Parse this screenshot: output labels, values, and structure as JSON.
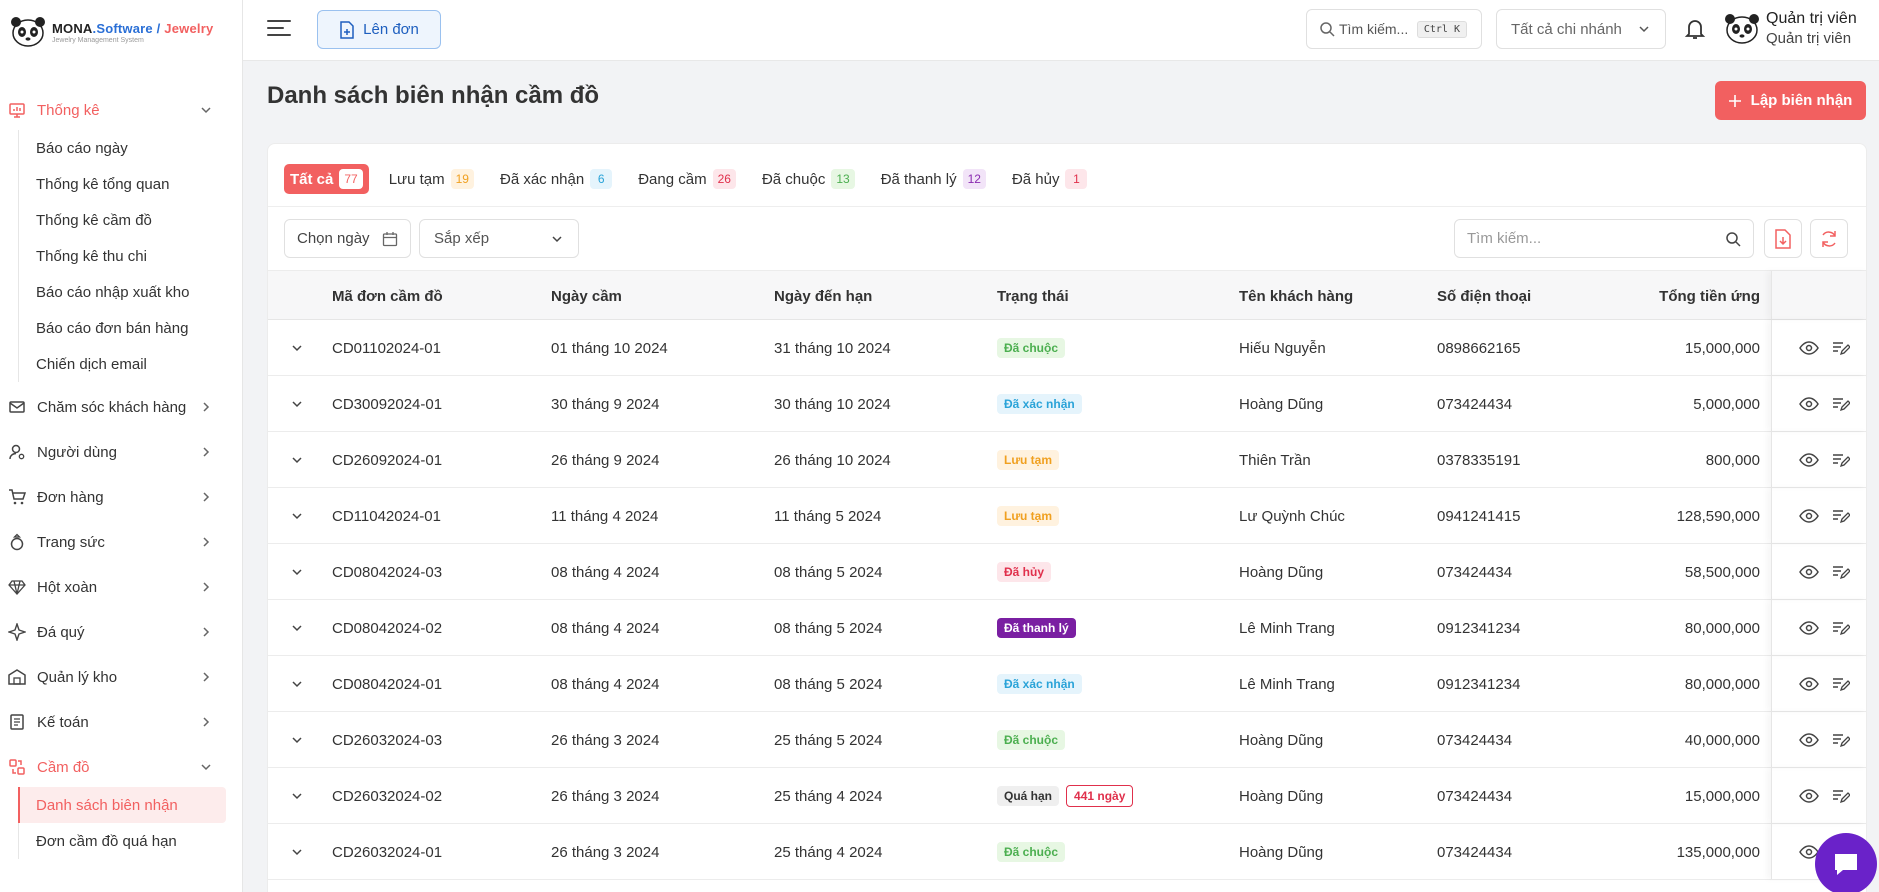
{
  "brand": {
    "name_main": "MONA",
    "name_dot": ".Software",
    "name_sep": " / ",
    "name_jewelry": "Jewelry",
    "subtitle": "Jewelry Management System"
  },
  "sidebar": {
    "groups": [
      {
        "label": "Thống kê",
        "icon": "chart-icon",
        "expanded": true,
        "active": true,
        "items": [
          "Báo cáo ngày",
          "Thống kê tổng quan",
          "Thống kê cầm đồ",
          "Thống kê thu chi",
          "Báo cáo nhập xuất kho",
          "Báo cáo đơn bán hàng",
          "Chiến dịch email"
        ]
      },
      {
        "label": "Chăm sóc khách hàng",
        "icon": "mail-icon"
      },
      {
        "label": "Người dùng",
        "icon": "user-gear-icon"
      },
      {
        "label": "Đơn hàng",
        "icon": "cart-icon"
      },
      {
        "label": "Trang sức",
        "icon": "ring-icon"
      },
      {
        "label": "Hột xoàn",
        "icon": "diamond-icon"
      },
      {
        "label": "Đá quý",
        "icon": "gem-icon"
      },
      {
        "label": "Quản lý kho",
        "icon": "warehouse-icon"
      },
      {
        "label": "Kế toán",
        "icon": "ledger-icon"
      },
      {
        "label": "Cầm đồ",
        "icon": "pawn-icon",
        "expanded": true,
        "active": true,
        "items": [
          "Danh sách biên nhận",
          "Đơn cầm đồ quá hạn"
        ],
        "active_item": 0
      }
    ]
  },
  "topbar": {
    "create_label": "Lên đơn",
    "search_label": "Tìm kiếm...",
    "search_shortcut": "Ctrl K",
    "branch_label": "Tất cả chi nhánh",
    "user_name": "Quản trị viên",
    "user_role": "Quản trị viên"
  },
  "page": {
    "title": "Danh sách biên nhận cầm đồ",
    "add_label": "Lập biên nhận",
    "tabs": [
      {
        "label": "Tất cả",
        "count": "77",
        "active": true,
        "color": "#f26060"
      },
      {
        "label": "Lưu tạm",
        "count": "19",
        "bg": "#fff2df",
        "fg": "#f0a020"
      },
      {
        "label": "Đã xác nhận",
        "count": "6",
        "bg": "#e5f4fc",
        "fg": "#2aa3d8"
      },
      {
        "label": "Đang cầm",
        "count": "26",
        "bg": "#fde6ea",
        "fg": "#e0304c"
      },
      {
        "label": "Đã chuộc",
        "count": "13",
        "bg": "#e7f7e3",
        "fg": "#4caf50"
      },
      {
        "label": "Đã thanh lý",
        "count": "12",
        "bg": "#f2e4f8",
        "fg": "#8a2bb0"
      },
      {
        "label": "Đã hủy",
        "count": "1",
        "bg": "#fde6ea",
        "fg": "#e0304c"
      }
    ],
    "date_placeholder": "Chọn ngày",
    "sort_placeholder": "Sắp xếp",
    "table_search_placeholder": "Tìm kiếm..."
  },
  "table": {
    "columns": [
      "Mã đơn cầm đồ",
      "Ngày cầm",
      "Ngày đến hạn",
      "Trạng thái",
      "Tên khách hàng",
      "Số điện thoại",
      "Tổng tiền ứng"
    ],
    "rows": [
      {
        "code": "CD01102024-01",
        "date": "01 tháng 10 2024",
        "due": "31 tháng 10 2024",
        "status": "Đã chuộc",
        "status_class": "b-green",
        "customer": "Hiếu Nguyễn",
        "phone": "0898662165",
        "total": "15,000,000"
      },
      {
        "code": "CD30092024-01",
        "date": "30 tháng 9 2024",
        "due": "30 tháng 10 2024",
        "status": "Đã xác nhận",
        "status_class": "b-blue",
        "customer": "Hoàng Dũng",
        "phone": "073424434",
        "total": "5,000,000"
      },
      {
        "code": "CD26092024-01",
        "date": "26 tháng 9 2024",
        "due": "26 tháng 10 2024",
        "status": "Lưu tạm",
        "status_class": "b-orange",
        "customer": "Thiên Trần",
        "phone": "0378335191",
        "total": "800,000"
      },
      {
        "code": "CD11042024-01",
        "date": "11 tháng 4 2024",
        "due": "11 tháng 5 2024",
        "status": "Lưu tạm",
        "status_class": "b-orange",
        "customer": "Lư Quỳnh Chúc",
        "phone": "0941241415",
        "total": "128,590,000"
      },
      {
        "code": "CD08042024-03",
        "date": "08 tháng 4 2024",
        "due": "08 tháng 5 2024",
        "status": "Đã hủy",
        "status_class": "b-red",
        "customer": "Hoàng Dũng",
        "phone": "073424434",
        "total": "58,500,000"
      },
      {
        "code": "CD08042024-02",
        "date": "08 tháng 4 2024",
        "due": "08 tháng 5 2024",
        "status": "Đã thanh lý",
        "status_class": "b-purple",
        "customer": "Lê Minh Trang",
        "phone": "0912341234",
        "total": "80,000,000"
      },
      {
        "code": "CD08042024-01",
        "date": "08 tháng 4 2024",
        "due": "08 tháng 5 2024",
        "status": "Đã xác nhận",
        "status_class": "b-blue",
        "customer": "Lê Minh Trang",
        "phone": "0912341234",
        "total": "80,000,000"
      },
      {
        "code": "CD26032024-03",
        "date": "26 tháng 3 2024",
        "due": "25 tháng 5 2024",
        "status": "Đã chuộc",
        "status_class": "b-green",
        "customer": "Hoàng Dũng",
        "phone": "073424434",
        "total": "40,000,000"
      },
      {
        "code": "CD26032024-02",
        "date": "26 tháng 3 2024",
        "due": "25 tháng 4 2024",
        "status": "Quá hạn",
        "status_class": "b-gray",
        "extra": "441 ngày",
        "customer": "Hoàng Dũng",
        "phone": "073424434",
        "total": "15,000,000"
      },
      {
        "code": "CD26032024-01",
        "date": "26 tháng 3 2024",
        "due": "25 tháng 4 2024",
        "status": "Đã chuộc",
        "status_class": "b-green",
        "customer": "Hoàng Dũng",
        "phone": "073424434",
        "total": "135,000,000"
      }
    ]
  },
  "colors": {
    "accent": "#f26060",
    "brand_blue": "#2a6fd6",
    "chat": "#6a22c9"
  }
}
